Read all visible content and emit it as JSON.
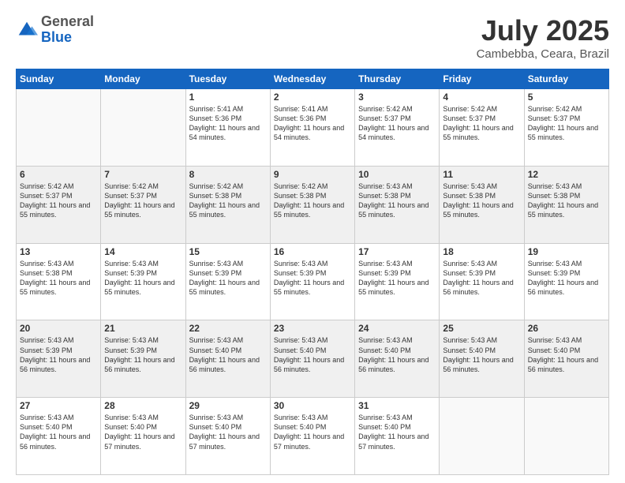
{
  "header": {
    "logo": {
      "general": "General",
      "blue": "Blue"
    },
    "title": "July 2025",
    "location": "Cambebba, Ceara, Brazil"
  },
  "weekdays": [
    "Sunday",
    "Monday",
    "Tuesday",
    "Wednesday",
    "Thursday",
    "Friday",
    "Saturday"
  ],
  "weeks": [
    [
      {
        "day": "",
        "sunrise": "",
        "sunset": "",
        "daylight": "",
        "empty": true
      },
      {
        "day": "",
        "sunrise": "",
        "sunset": "",
        "daylight": "",
        "empty": true
      },
      {
        "day": "1",
        "sunrise": "Sunrise: 5:41 AM",
        "sunset": "Sunset: 5:36 PM",
        "daylight": "Daylight: 11 hours and 54 minutes."
      },
      {
        "day": "2",
        "sunrise": "Sunrise: 5:41 AM",
        "sunset": "Sunset: 5:36 PM",
        "daylight": "Daylight: 11 hours and 54 minutes."
      },
      {
        "day": "3",
        "sunrise": "Sunrise: 5:42 AM",
        "sunset": "Sunset: 5:37 PM",
        "daylight": "Daylight: 11 hours and 54 minutes."
      },
      {
        "day": "4",
        "sunrise": "Sunrise: 5:42 AM",
        "sunset": "Sunset: 5:37 PM",
        "daylight": "Daylight: 11 hours and 55 minutes."
      },
      {
        "day": "5",
        "sunrise": "Sunrise: 5:42 AM",
        "sunset": "Sunset: 5:37 PM",
        "daylight": "Daylight: 11 hours and 55 minutes."
      }
    ],
    [
      {
        "day": "6",
        "sunrise": "Sunrise: 5:42 AM",
        "sunset": "Sunset: 5:37 PM",
        "daylight": "Daylight: 11 hours and 55 minutes."
      },
      {
        "day": "7",
        "sunrise": "Sunrise: 5:42 AM",
        "sunset": "Sunset: 5:37 PM",
        "daylight": "Daylight: 11 hours and 55 minutes."
      },
      {
        "day": "8",
        "sunrise": "Sunrise: 5:42 AM",
        "sunset": "Sunset: 5:38 PM",
        "daylight": "Daylight: 11 hours and 55 minutes."
      },
      {
        "day": "9",
        "sunrise": "Sunrise: 5:42 AM",
        "sunset": "Sunset: 5:38 PM",
        "daylight": "Daylight: 11 hours and 55 minutes."
      },
      {
        "day": "10",
        "sunrise": "Sunrise: 5:43 AM",
        "sunset": "Sunset: 5:38 PM",
        "daylight": "Daylight: 11 hours and 55 minutes."
      },
      {
        "day": "11",
        "sunrise": "Sunrise: 5:43 AM",
        "sunset": "Sunset: 5:38 PM",
        "daylight": "Daylight: 11 hours and 55 minutes."
      },
      {
        "day": "12",
        "sunrise": "Sunrise: 5:43 AM",
        "sunset": "Sunset: 5:38 PM",
        "daylight": "Daylight: 11 hours and 55 minutes."
      }
    ],
    [
      {
        "day": "13",
        "sunrise": "Sunrise: 5:43 AM",
        "sunset": "Sunset: 5:38 PM",
        "daylight": "Daylight: 11 hours and 55 minutes."
      },
      {
        "day": "14",
        "sunrise": "Sunrise: 5:43 AM",
        "sunset": "Sunset: 5:39 PM",
        "daylight": "Daylight: 11 hours and 55 minutes."
      },
      {
        "day": "15",
        "sunrise": "Sunrise: 5:43 AM",
        "sunset": "Sunset: 5:39 PM",
        "daylight": "Daylight: 11 hours and 55 minutes."
      },
      {
        "day": "16",
        "sunrise": "Sunrise: 5:43 AM",
        "sunset": "Sunset: 5:39 PM",
        "daylight": "Daylight: 11 hours and 55 minutes."
      },
      {
        "day": "17",
        "sunrise": "Sunrise: 5:43 AM",
        "sunset": "Sunset: 5:39 PM",
        "daylight": "Daylight: 11 hours and 55 minutes."
      },
      {
        "day": "18",
        "sunrise": "Sunrise: 5:43 AM",
        "sunset": "Sunset: 5:39 PM",
        "daylight": "Daylight: 11 hours and 56 minutes."
      },
      {
        "day": "19",
        "sunrise": "Sunrise: 5:43 AM",
        "sunset": "Sunset: 5:39 PM",
        "daylight": "Daylight: 11 hours and 56 minutes."
      }
    ],
    [
      {
        "day": "20",
        "sunrise": "Sunrise: 5:43 AM",
        "sunset": "Sunset: 5:39 PM",
        "daylight": "Daylight: 11 hours and 56 minutes."
      },
      {
        "day": "21",
        "sunrise": "Sunrise: 5:43 AM",
        "sunset": "Sunset: 5:39 PM",
        "daylight": "Daylight: 11 hours and 56 minutes."
      },
      {
        "day": "22",
        "sunrise": "Sunrise: 5:43 AM",
        "sunset": "Sunset: 5:40 PM",
        "daylight": "Daylight: 11 hours and 56 minutes."
      },
      {
        "day": "23",
        "sunrise": "Sunrise: 5:43 AM",
        "sunset": "Sunset: 5:40 PM",
        "daylight": "Daylight: 11 hours and 56 minutes."
      },
      {
        "day": "24",
        "sunrise": "Sunrise: 5:43 AM",
        "sunset": "Sunset: 5:40 PM",
        "daylight": "Daylight: 11 hours and 56 minutes."
      },
      {
        "day": "25",
        "sunrise": "Sunrise: 5:43 AM",
        "sunset": "Sunset: 5:40 PM",
        "daylight": "Daylight: 11 hours and 56 minutes."
      },
      {
        "day": "26",
        "sunrise": "Sunrise: 5:43 AM",
        "sunset": "Sunset: 5:40 PM",
        "daylight": "Daylight: 11 hours and 56 minutes."
      }
    ],
    [
      {
        "day": "27",
        "sunrise": "Sunrise: 5:43 AM",
        "sunset": "Sunset: 5:40 PM",
        "daylight": "Daylight: 11 hours and 56 minutes."
      },
      {
        "day": "28",
        "sunrise": "Sunrise: 5:43 AM",
        "sunset": "Sunset: 5:40 PM",
        "daylight": "Daylight: 11 hours and 57 minutes."
      },
      {
        "day": "29",
        "sunrise": "Sunrise: 5:43 AM",
        "sunset": "Sunset: 5:40 PM",
        "daylight": "Daylight: 11 hours and 57 minutes."
      },
      {
        "day": "30",
        "sunrise": "Sunrise: 5:43 AM",
        "sunset": "Sunset: 5:40 PM",
        "daylight": "Daylight: 11 hours and 57 minutes."
      },
      {
        "day": "31",
        "sunrise": "Sunrise: 5:43 AM",
        "sunset": "Sunset: 5:40 PM",
        "daylight": "Daylight: 11 hours and 57 minutes."
      },
      {
        "day": "",
        "sunrise": "",
        "sunset": "",
        "daylight": "",
        "empty": true
      },
      {
        "day": "",
        "sunrise": "",
        "sunset": "",
        "daylight": "",
        "empty": true
      }
    ]
  ]
}
